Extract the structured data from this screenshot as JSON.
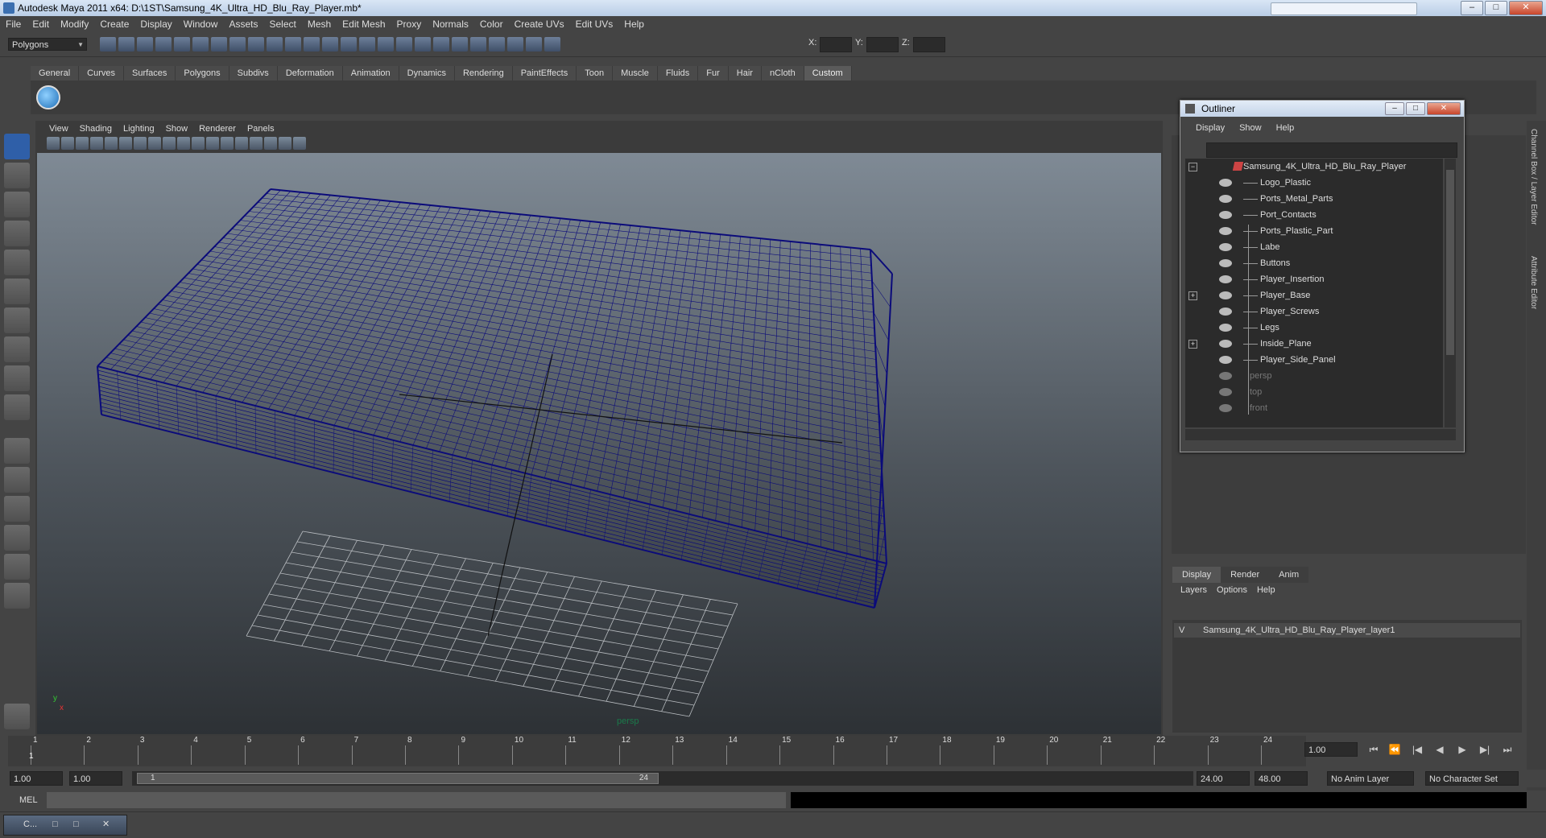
{
  "window": {
    "title": "Autodesk Maya 2011 x64: D:\\1ST\\Samsung_4K_Ultra_HD_Blu_Ray_Player.mb*",
    "minimize": "–",
    "maximize": "□",
    "close": "✕"
  },
  "menubar": [
    "File",
    "Edit",
    "Modify",
    "Create",
    "Display",
    "Window",
    "Assets",
    "Select",
    "Mesh",
    "Edit Mesh",
    "Proxy",
    "Normals",
    "Color",
    "Create UVs",
    "Edit UVs",
    "Help"
  ],
  "toolbar": {
    "mode": "Polygons",
    "x_label": "X:",
    "y_label": "Y:",
    "z_label": "Z:"
  },
  "shelf_tabs": [
    "General",
    "Curves",
    "Surfaces",
    "Polygons",
    "Subdivs",
    "Deformation",
    "Animation",
    "Dynamics",
    "Rendering",
    "PaintEffects",
    "Toon",
    "Muscle",
    "Fluids",
    "Fur",
    "Hair",
    "nCloth",
    "Custom"
  ],
  "active_shelf_tab": "Custom",
  "viewport": {
    "menu": [
      "View",
      "Shading",
      "Lighting",
      "Show",
      "Renderer",
      "Panels"
    ],
    "camera_label": "persp",
    "axis_x": "x",
    "axis_y": "y",
    "wire_color": "#0b0b7a"
  },
  "outliner": {
    "title": "Outliner",
    "menu": [
      "Display",
      "Show",
      "Help"
    ],
    "root": "Samsung_4K_Ultra_HD_Blu_Ray_Player",
    "children": [
      "Logo_Plastic",
      "Ports_Metal_Parts",
      "Port_Contacts",
      "Ports_Plastic_Part",
      "Labe",
      "Buttons",
      "Player_Insertion",
      "Player_Base",
      "Player_Screws",
      "Legs",
      "Inside_Plane",
      "Player_Side_Panel"
    ],
    "cameras": [
      "persp",
      "top",
      "front"
    ],
    "expand_symbol_open": "−",
    "expand_symbol_closed": "+"
  },
  "side_tabs": [
    "Channel Box / Layer Editor",
    "Attribute Editor"
  ],
  "layer_editor": {
    "tabs": [
      "Display",
      "Render",
      "Anim"
    ],
    "menu": [
      "Layers",
      "Options",
      "Help"
    ],
    "layer_visible": "V",
    "layer_name": "Samsung_4K_Ultra_HD_Blu_Ray_Player_layer1"
  },
  "timeline": {
    "ticks": [
      "1",
      "2",
      "3",
      "4",
      "5",
      "6",
      "7",
      "8",
      "9",
      "10",
      "11",
      "12",
      "13",
      "14",
      "15",
      "16",
      "17",
      "18",
      "19",
      "20",
      "21",
      "22",
      "23",
      "24"
    ],
    "current_frame": "1.00",
    "playhead": "1",
    "play_controls": [
      "⏮",
      "⏪",
      "|◀",
      "◀",
      "▶",
      "▶|",
      "⏭"
    ]
  },
  "range": {
    "start": "1.00",
    "playback_start": "1.00",
    "slider_start": "1",
    "slider_end": "24",
    "playback_end": "24.00",
    "end": "48.00",
    "anim_layer": "No Anim Layer",
    "character_set": "No Character Set"
  },
  "command_line": {
    "label": "MEL"
  },
  "minimized_window": {
    "label": "C..."
  }
}
